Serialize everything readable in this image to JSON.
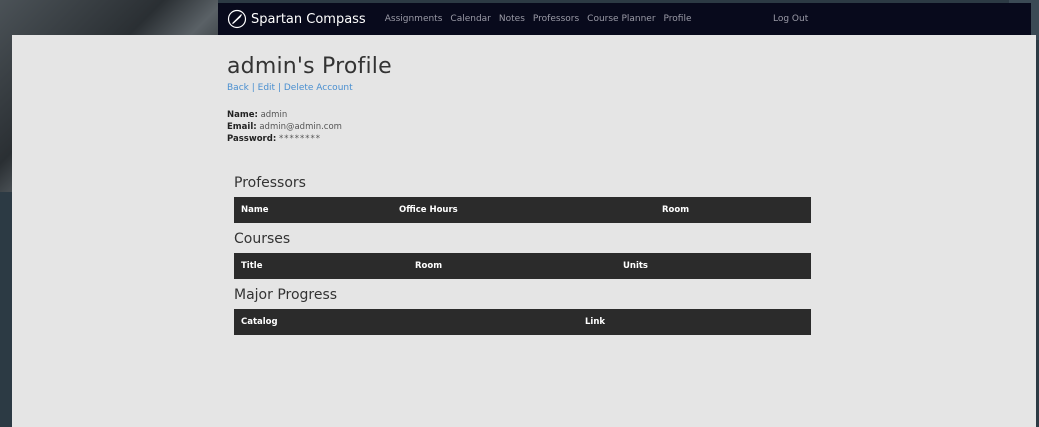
{
  "navbar": {
    "brand": "Spartan Compass",
    "links": [
      "Assignments",
      "Calendar",
      "Notes",
      "Professors",
      "Course Planner",
      "Profile"
    ],
    "logout": "Log Out"
  },
  "profile": {
    "title": "admin's Profile",
    "actions": {
      "back": "Back",
      "edit": "Edit",
      "delete": "Delete Account",
      "separator": "|"
    },
    "name_label": "Name:",
    "name_value": "admin",
    "email_label": "Email:",
    "email_value": "admin@admin.com",
    "password_label": "Password:",
    "password_value": "********"
  },
  "sections": {
    "professors": {
      "title": "Professors",
      "columns": [
        "Name",
        "Office Hours",
        "Room"
      ]
    },
    "courses": {
      "title": "Courses",
      "columns": [
        "Title",
        "Room",
        "Units"
      ]
    },
    "major_progress": {
      "title": "Major Progress",
      "columns": [
        "Catalog",
        "Link"
      ]
    }
  },
  "colors": {
    "navbar_bg": "#080a1c",
    "page_bg": "#e5e5e5",
    "table_header_bg": "#2b2b2b",
    "link": "#4a8fd0"
  }
}
